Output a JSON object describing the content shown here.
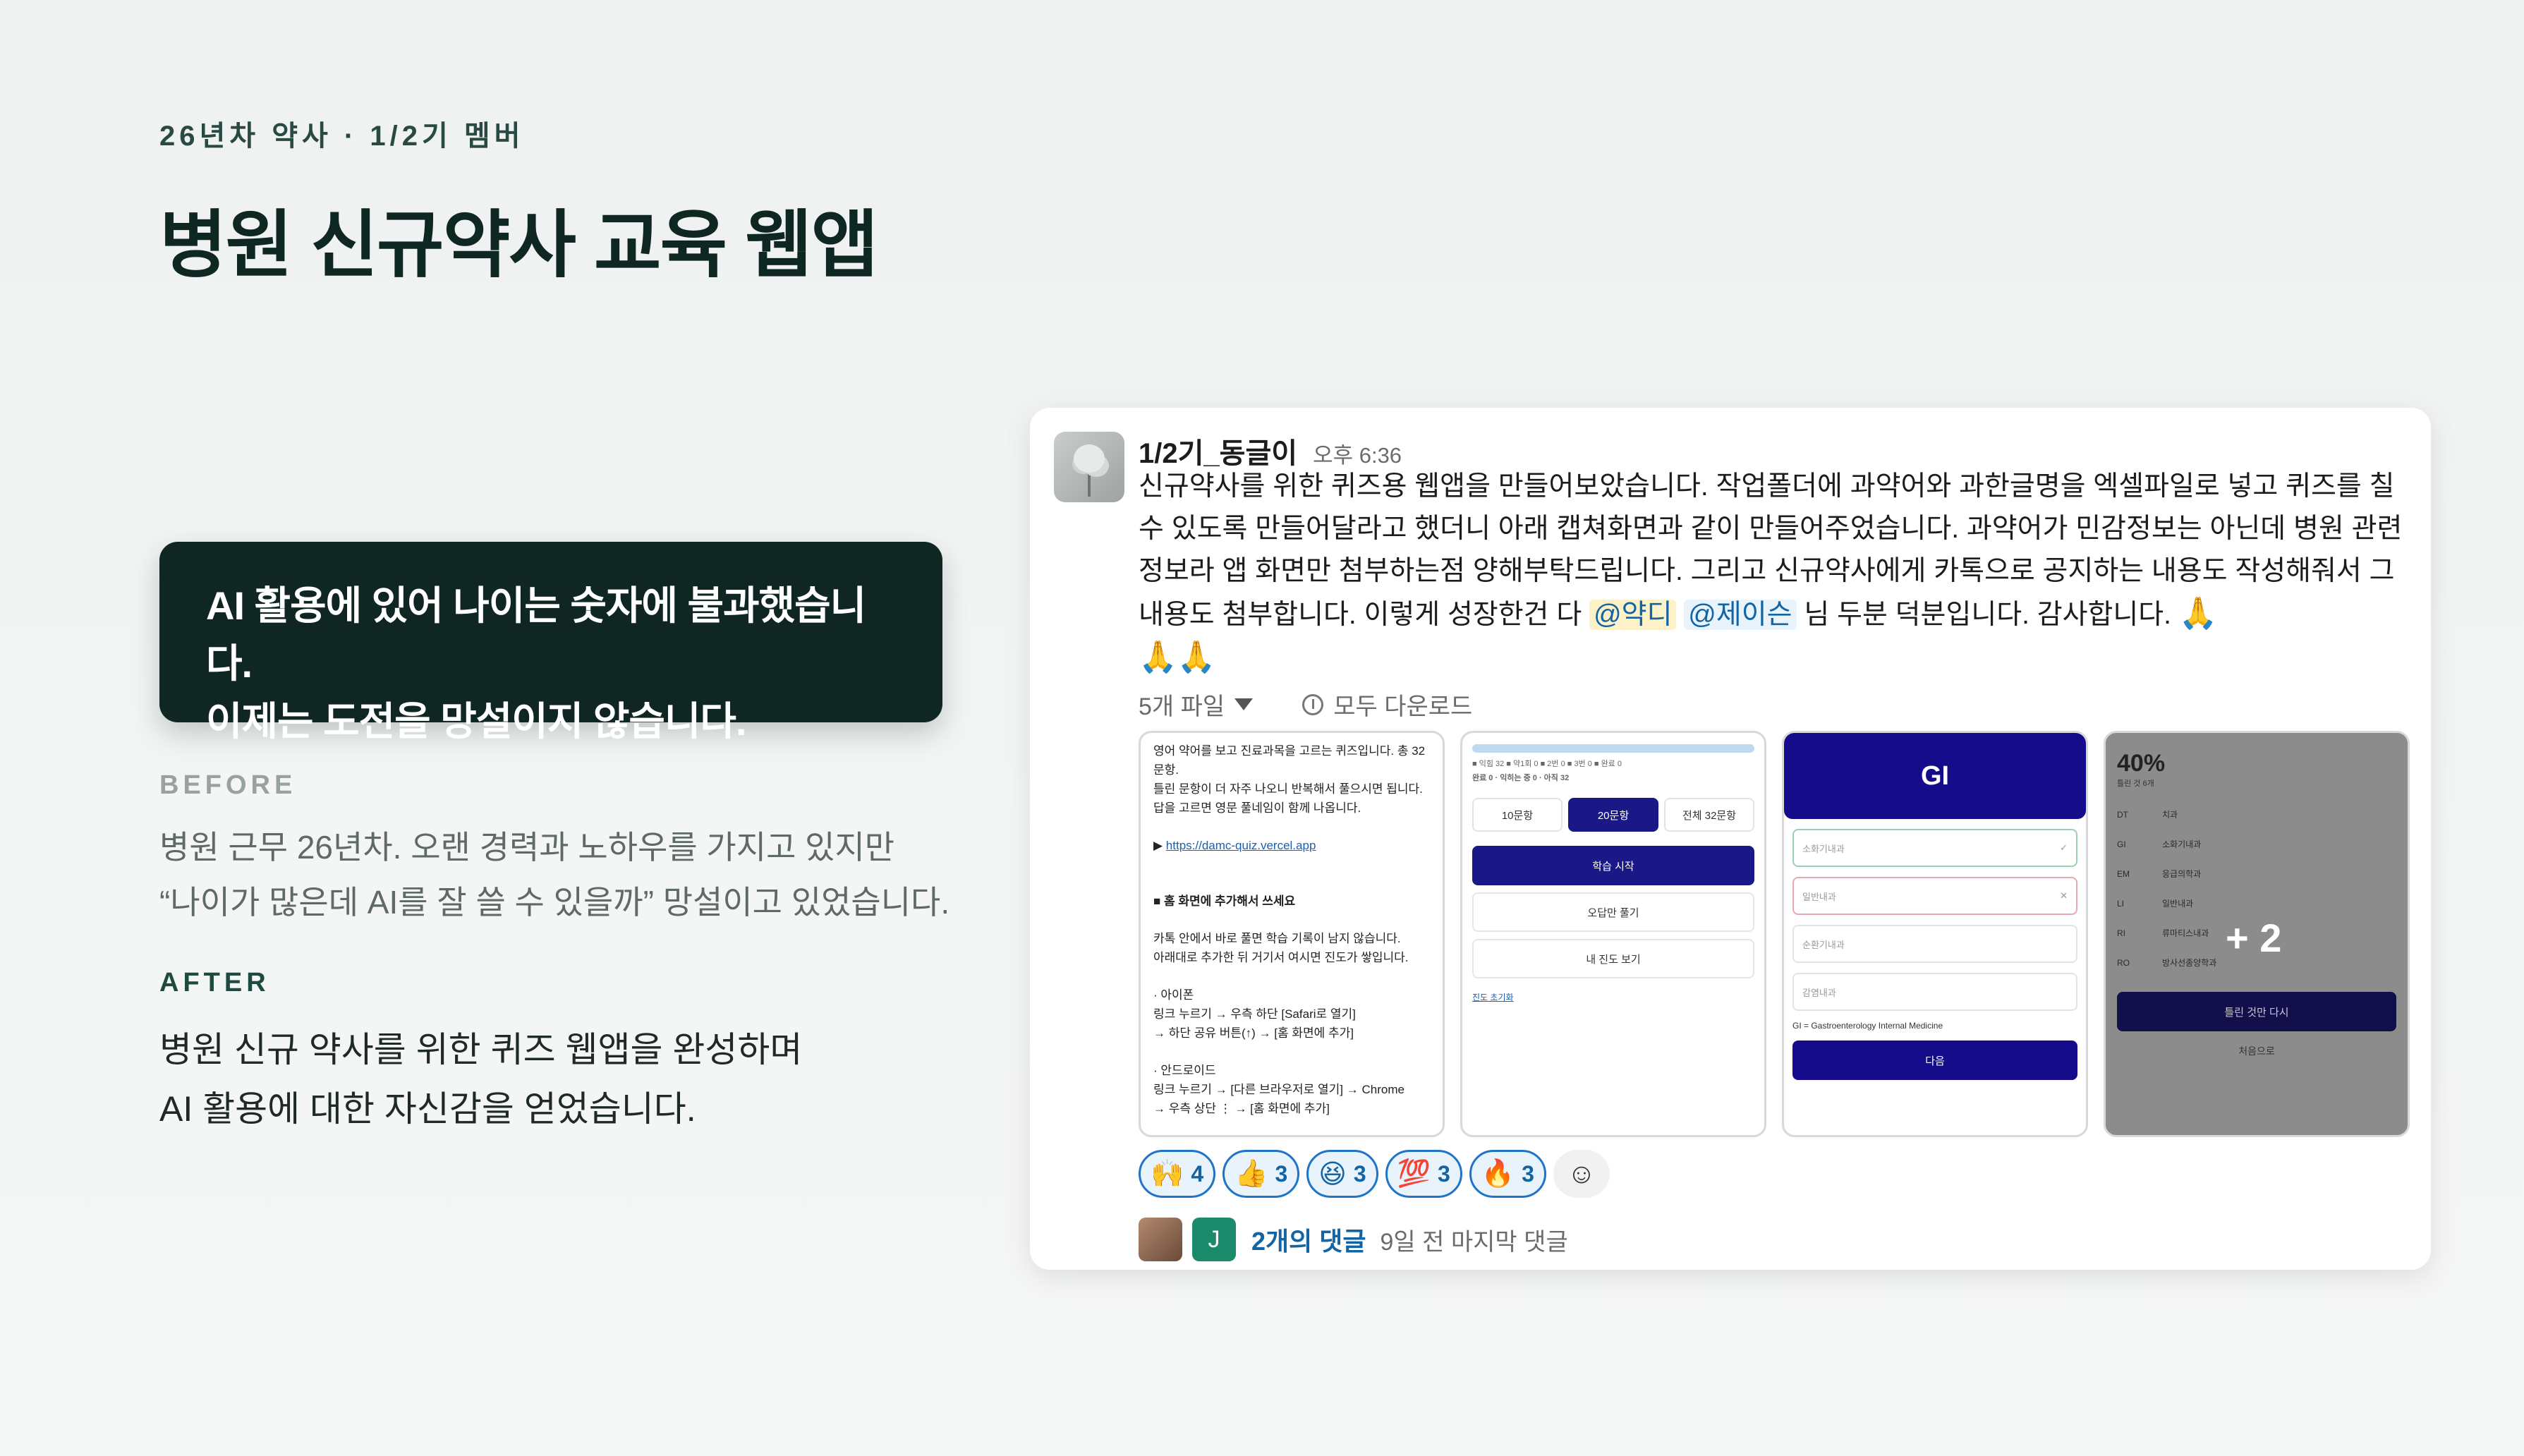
{
  "kicker": "26년차 약사 · 1/2기 멤버",
  "title": "병원 신규약사 교육 웹앱",
  "quote": {
    "line1": "AI 활용에 있어 나이는 숫자에 불과했습니다.",
    "line2": "이제는 도전을 망설이지 않습니다."
  },
  "before": {
    "label": "BEFORE",
    "line1": "병원 근무 26년차. 오랜 경력과 노하우를 가지고 있지만",
    "line2": "“나이가 많은데 AI를 잘 쓸 수 있을까” 망설이고 있었습니다."
  },
  "after": {
    "label": "AFTER",
    "line1": "병원 신규 약사를 위한 퀴즈 웹앱을 완성하며",
    "line2": "AI 활용에 대한 자신감을 얻었습니다."
  },
  "message": {
    "author": "1/2기_동글이",
    "time": "오후 6:36",
    "body_part1": "신규약사를 위한 퀴즈용 웹앱을 만들어보았습니다. 작업폴더에 과약어와 과한글명을 엑셀파일로 넣고 퀴즈를 칠수 있도록 만들어달라고 했더니 아래 캡쳐화면과 같이 만들어주었습니다. 과약어가 민감정보는 아닌데 병원 관련 정보라 앱 화면만 첨부하는점 양해부탁드립니다. 그리고 신규약사에게 카톡으로 공지하는 내용도 작성해줘서 그 내용도 첨부합니다. 이렇게 성장한건 다 ",
    "mention1": "@약디",
    "mention2": "@제이슨",
    "body_part2": " 님 두분 덕분입니다. 감사합니다.",
    "pray1": "🙏",
    "pray2": "🙏🙏",
    "files_label": "5개 파일",
    "download_all": "모두 다운로드",
    "thumb1": {
      "l1": "영어 약어를 보고 진료과목을 고르는 퀴즈입니다. 총 32",
      "l2": "문항.",
      "l3": "틀린 문항이 더 자주 나오니 반복해서 풀으시면 됩니다.",
      "l4": "답을 고르면 영문 풀네임이 함께 나옵니다.",
      "link": "https://damc-quiz.vercel.app",
      "h1": "■ 홈 화면에 추가해서 쓰세요",
      "l5": "카톡 안에서 바로 풀면 학습 기록이 남지 않습니다.",
      "l6": "아래대로 추가한 뒤 거기서 여시면 진도가 쌓입니다.",
      "l7": "· 아이폰",
      "l8": "링크 누르기 → 우측 하단 [Safari로 열기]",
      "l9": "→ 하단 공유 버튼(↑) → [홈 화면에 추가]",
      "l10": "· 안드로이드",
      "l11": "링크 누르기 → [다른 브라우저로 열기] → Chrome",
      "l12": "→ 우측 상단 ⋮ → [홈 화면에 추가]"
    },
    "thumb2": {
      "stats1": "■ 익힘 32  ■ 약1회 0  ■ 2번 0  ■ 3번 0  ■ 완료 0",
      "stats2": "완료 0 · 익히는 중 0 · 아직 32",
      "seg1": "10문항",
      "seg2": "20문항",
      "seg3": "전체 32문항",
      "start": "학습 시작",
      "wrong": "오답만 풀기",
      "progress": "내 진도 보기",
      "reset": "진도 초기화"
    },
    "thumb3": {
      "header": "GI",
      "opt1": "소화기내과",
      "opt2": "일반내과",
      "opt3": "순환기내과",
      "opt4": "감염내과",
      "note": "GI = Gastroenterology Internal Medicine",
      "next": "다음"
    },
    "thumb4": {
      "pct": "40%",
      "sub": "틀린 것 6개",
      "rows": [
        {
          "k": "DT",
          "v": "치과"
        },
        {
          "k": "GI",
          "v": "소화기내과"
        },
        {
          "k": "EM",
          "v": "응급의학과"
        },
        {
          "k": "LI",
          "v": "일반내과"
        },
        {
          "k": "RI",
          "v": "류마티스내과"
        },
        {
          "k": "RO",
          "v": "방사선종양학과"
        }
      ],
      "retry": "틀린 것만 다시",
      "home": "처음으로",
      "more": "+ 2"
    },
    "reactions": [
      {
        "emoji": "🙌",
        "count": "4"
      },
      {
        "emoji": "👍",
        "count": "3"
      },
      {
        "emoji": "😆",
        "count": "3"
      },
      {
        "emoji": "💯",
        "count": "3"
      },
      {
        "emoji": "🔥",
        "count": "3"
      }
    ],
    "reply_avatar_letter": "J",
    "reply_count": "2개의 댓글",
    "reply_last": "9일 전 마지막 댓글"
  }
}
